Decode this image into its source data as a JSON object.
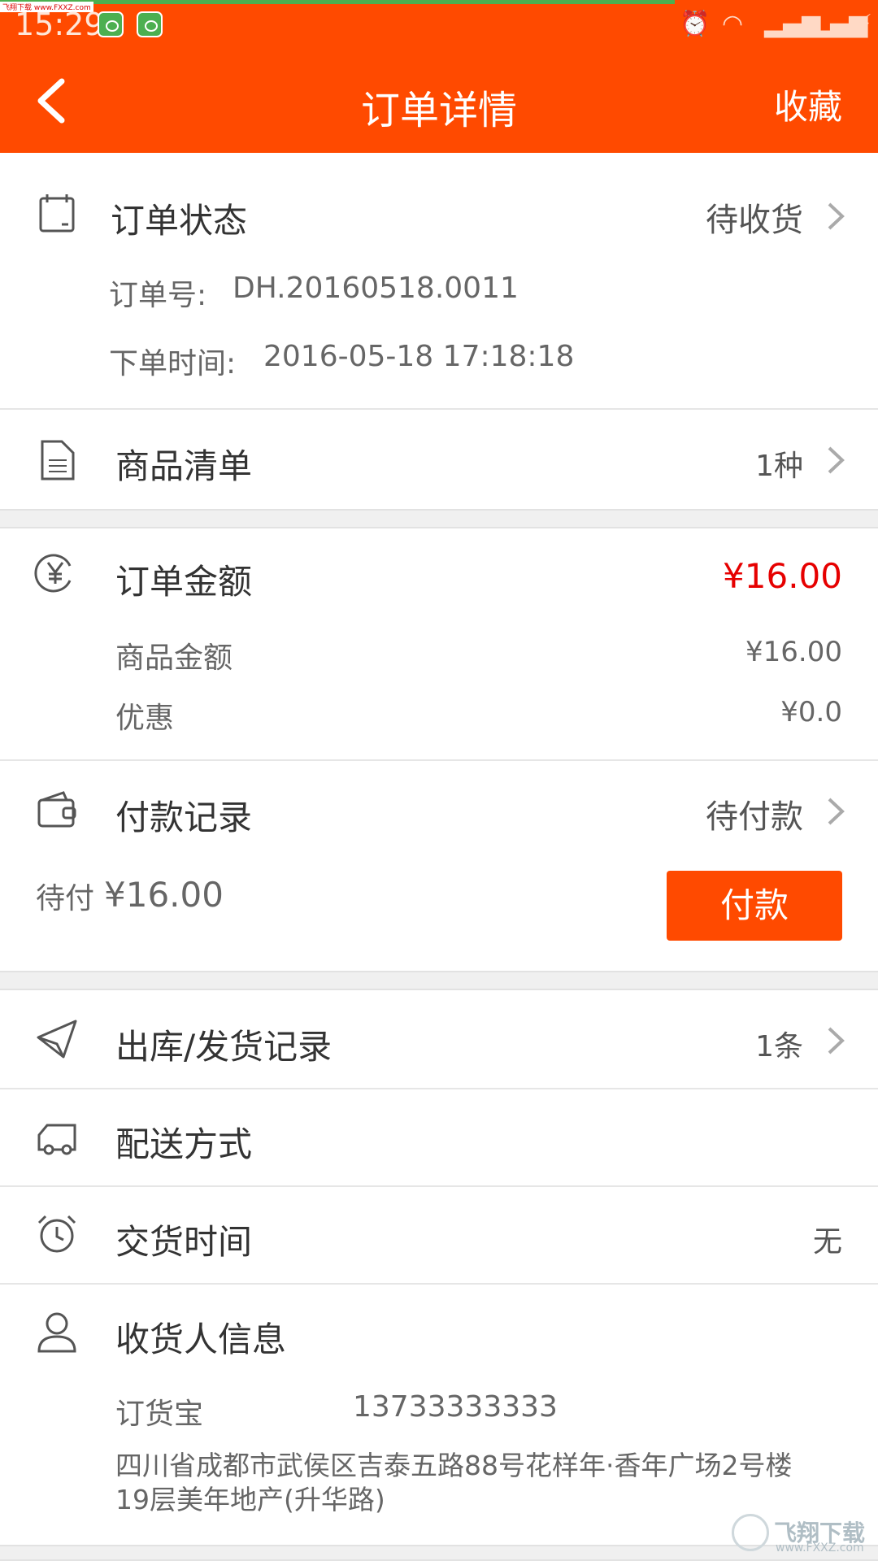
{
  "status_bar": {
    "time": "15:29",
    "watermark_top": "飞翔下载 www.FXXZ.com",
    "icons": [
      "android-icon",
      "android-icon",
      "alarm-icon",
      "wifi-icon",
      "signal-icon",
      "signal-icon",
      "charging-icon"
    ]
  },
  "header": {
    "back_icon": "back-arrow-icon",
    "title": "订单详情",
    "favorite_label": "收藏"
  },
  "order_status": {
    "title": "订单状态",
    "value": "待收货",
    "order_no_label": "订单号:",
    "order_no": "DH.20160518.0011",
    "order_time_label": "下单时间:",
    "order_time": "2016-05-18 17:18:18"
  },
  "goods_list": {
    "title": "商品清单",
    "value": "1种"
  },
  "order_amount": {
    "title": "订单金额",
    "value": "¥16.00",
    "goods_amount_label": "商品金额",
    "goods_amount": "¥16.00",
    "discount_label": "优惠",
    "discount": "¥0.0"
  },
  "payment": {
    "title": "付款记录",
    "status": "待付款",
    "pending_label": "待付",
    "pending_amount": "¥16.00",
    "pay_button": "付款"
  },
  "shipping_record": {
    "title": "出库/发货记录",
    "value": "1条"
  },
  "delivery_method": {
    "title": "配送方式"
  },
  "delivery_time": {
    "title": "交货时间",
    "value": "无"
  },
  "receiver": {
    "title": "收货人信息",
    "name": "订货宝",
    "phone": "13733333333",
    "address_line1": "四川省成都市武侯区吉泰五路88号花样年·香年广场2号楼",
    "address_line2": "19层美年地产(升华路)"
  },
  "watermark": {
    "text": "飞翔下载",
    "url": "www.FXXZ.com"
  },
  "colors": {
    "accent": "#ff4a00",
    "price": "#e60000",
    "text": "#333333",
    "muted": "#666666"
  }
}
